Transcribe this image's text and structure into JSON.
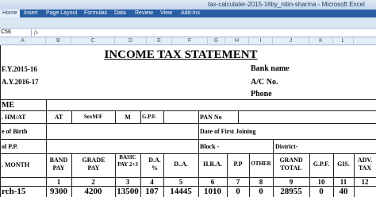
{
  "window": {
    "title": "tax-calculater-2015-16by_nitin-sharma - Microsoft Excel"
  },
  "ribbon": {
    "tabs": [
      "Home",
      "Insert",
      "Page Layout",
      "Formulas",
      "Data",
      "Review",
      "View",
      "Add-Ins"
    ]
  },
  "formula_bar": {
    "cell_ref": "C56",
    "fx": "fx"
  },
  "columns": [
    "A",
    "B",
    "C",
    "D",
    "E",
    "F",
    "G",
    "H",
    "I",
    "J",
    "K",
    "L"
  ],
  "sheet": {
    "title": "INCOME TAX STATEMENT",
    "fy": "F.Y.2015-16",
    "ay": "A.Y.2016-17",
    "bank_name": "Bank name",
    "ac_no": "A/C No.",
    "phone": "Phone",
    "name_label": "ME",
    "hm_at": ". HM/AT",
    "at": "AT",
    "sex": "SexM/F",
    "m": "M",
    "gpf_small": "G.P.F.",
    "pan": "PAN No",
    "dob": "e of Birth",
    "doj": "Date of First Joining",
    "pp": "ol P.P.",
    "block": "Block -",
    "district": "District-",
    "headers": {
      "month": ". MONTH",
      "band_pay": "BAND PAY",
      "grade_pay": "GRADE PAY",
      "basic_pay": "BASIC PAY 2+3",
      "da_pct": "D.A. %",
      "da": "D..A.",
      "hra": "H.R.A.",
      "pp": "P.P",
      "other": "OTHER",
      "grand_total": "GRAND TOTAL",
      "gpf": "G.P.F.",
      "gis": "GIS.",
      "adv_tax": "ADV. TAX"
    },
    "index_row": [
      "1",
      "2",
      "3",
      "4",
      "5",
      "6",
      "7",
      "8",
      "9",
      "10",
      "11",
      "12"
    ],
    "data_row": {
      "month": "rch-15",
      "band_pay": "9300",
      "grade_pay": "4200",
      "basic_pay": "13500",
      "da_pct": "107",
      "da": "14445",
      "hra": "1010",
      "pp": "0",
      "other": "0",
      "grand_total": "28955",
      "gpf": "0",
      "gis": "40"
    }
  }
}
